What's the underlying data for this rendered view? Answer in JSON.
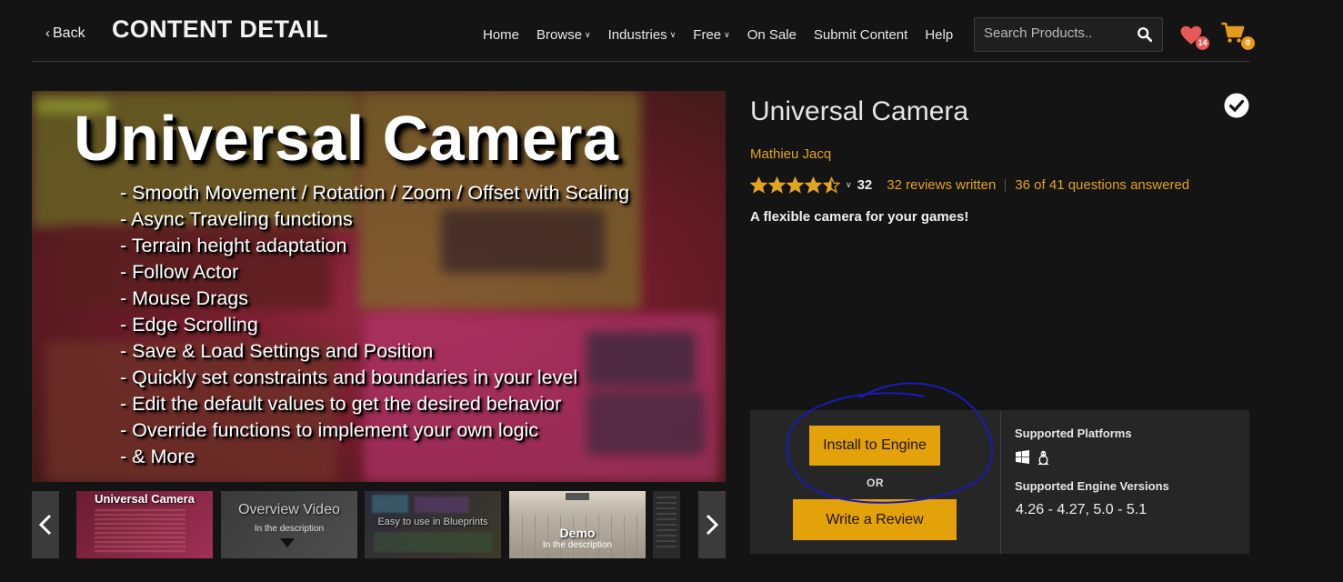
{
  "header": {
    "back_label": "Back",
    "page_title": "CONTENT DETAIL",
    "nav": [
      {
        "label": "Home",
        "dropdown": false
      },
      {
        "label": "Browse",
        "dropdown": true
      },
      {
        "label": "Industries",
        "dropdown": true
      },
      {
        "label": "Free",
        "dropdown": true
      },
      {
        "label": "On Sale",
        "dropdown": false
      },
      {
        "label": "Submit Content",
        "dropdown": false
      },
      {
        "label": "Help",
        "dropdown": false
      }
    ],
    "search_placeholder": "Search Products..",
    "wishlist_count": "14",
    "cart_count": "0"
  },
  "hero": {
    "title": "Universal Camera",
    "features": [
      "- Smooth Movement / Rotation / Zoom / Offset with Scaling",
      "- Async Traveling functions",
      "- Terrain height adaptation",
      "- Follow Actor",
      "- Mouse Drags",
      "- Edge Scrolling",
      "- Save & Load Settings and Position",
      "- Quickly set constraints and boundaries in your level",
      "- Edit the default values to get the desired behavior",
      "- Override functions to implement your own logic",
      "- & More"
    ]
  },
  "thumbnails": [
    {
      "label": "Universal Camera",
      "sub": ""
    },
    {
      "label": "Overview Video",
      "sub": "In the description"
    },
    {
      "label": "Easy to use in Blueprints",
      "sub": ""
    },
    {
      "label": "Demo",
      "sub": "In the description"
    }
  ],
  "product": {
    "name": "Universal Camera",
    "author": "Mathieu Jacq",
    "rating": 4.5,
    "rating_count": "32",
    "reviews_link": "32 reviews written",
    "questions_link": "36 of 41 questions answered",
    "tagline": "A flexible camera for your games!"
  },
  "actions": {
    "install_label": "Install to Engine",
    "or_label": "OR",
    "review_label": "Write a Review",
    "platforms_title": "Supported Platforms",
    "platforms": [
      "windows-icon",
      "linux-icon"
    ],
    "engine_title": "Supported Engine Versions",
    "engine_versions": "4.26 - 4.27, 5.0 - 5.1"
  },
  "colors": {
    "accent": "#e3a10a",
    "link": "#e3a41f",
    "background": "#141414",
    "panel": "#262626",
    "annotation": "#1a1ab8"
  }
}
